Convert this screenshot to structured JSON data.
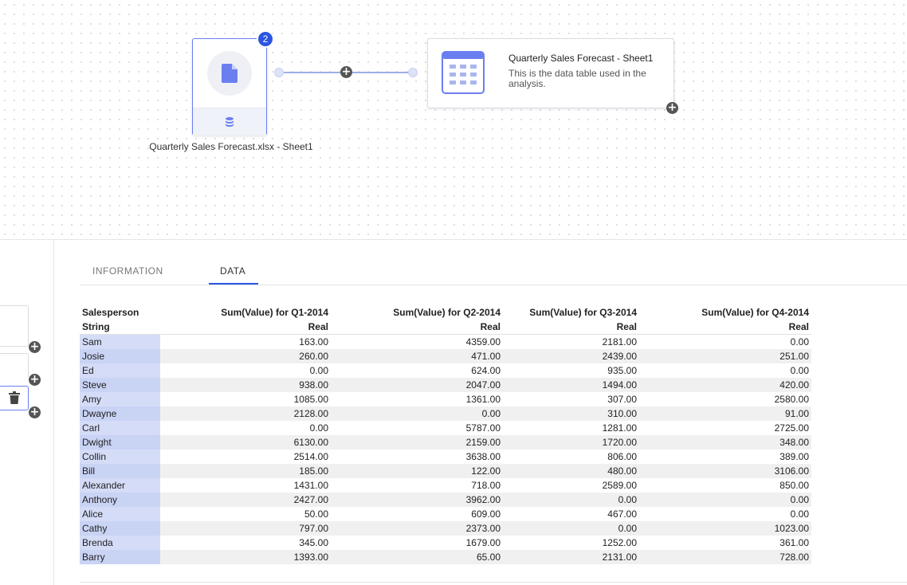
{
  "canvas": {
    "source_node": {
      "badge": "2",
      "label": "Quarterly Sales Forecast.xlsx - Sheet1",
      "icon": "document-icon",
      "sub_icon": "database-icon"
    },
    "target_node": {
      "title": "Quarterly Sales Forecast - Sheet1",
      "description": "This is the data table used in the analysis.",
      "icon": "table-icon"
    },
    "add_symbol": "+"
  },
  "tabs": {
    "information": "INFORMATION",
    "data": "DATA"
  },
  "table": {
    "headers": [
      "Salesperson",
      "Sum(Value) for Q1-2014",
      "Sum(Value) for Q2-2014",
      "Sum(Value) for Q3-2014",
      "Sum(Value) for Q4-2014"
    ],
    "types": [
      "String",
      "Real",
      "Real",
      "Real",
      "Real"
    ],
    "rows": [
      [
        "Sam",
        "163.00",
        "4359.00",
        "2181.00",
        "0.00"
      ],
      [
        "Josie",
        "260.00",
        "471.00",
        "2439.00",
        "251.00"
      ],
      [
        "Ed",
        "0.00",
        "624.00",
        "935.00",
        "0.00"
      ],
      [
        "Steve",
        "938.00",
        "2047.00",
        "1494.00",
        "420.00"
      ],
      [
        "Amy",
        "1085.00",
        "1361.00",
        "307.00",
        "2580.00"
      ],
      [
        "Dwayne",
        "2128.00",
        "0.00",
        "310.00",
        "91.00"
      ],
      [
        "Carl",
        "0.00",
        "5787.00",
        "1281.00",
        "2725.00"
      ],
      [
        "Dwight",
        "6130.00",
        "2159.00",
        "1720.00",
        "348.00"
      ],
      [
        "Collin",
        "2514.00",
        "3638.00",
        "806.00",
        "389.00"
      ],
      [
        "Bill",
        "185.00",
        "122.00",
        "480.00",
        "3106.00"
      ],
      [
        "Alexander",
        "1431.00",
        "718.00",
        "2589.00",
        "850.00"
      ],
      [
        "Anthony",
        "2427.00",
        "3962.00",
        "0.00",
        "0.00"
      ],
      [
        "Alice",
        "50.00",
        "609.00",
        "467.00",
        "0.00"
      ],
      [
        "Cathy",
        "797.00",
        "2373.00",
        "0.00",
        "1023.00"
      ],
      [
        "Brenda",
        "345.00",
        "1679.00",
        "1252.00",
        "361.00"
      ],
      [
        "Barry",
        "1393.00",
        "65.00",
        "2131.00",
        "728.00"
      ]
    ]
  },
  "left_panel": {
    "icons": [
      "trash-icon"
    ]
  }
}
